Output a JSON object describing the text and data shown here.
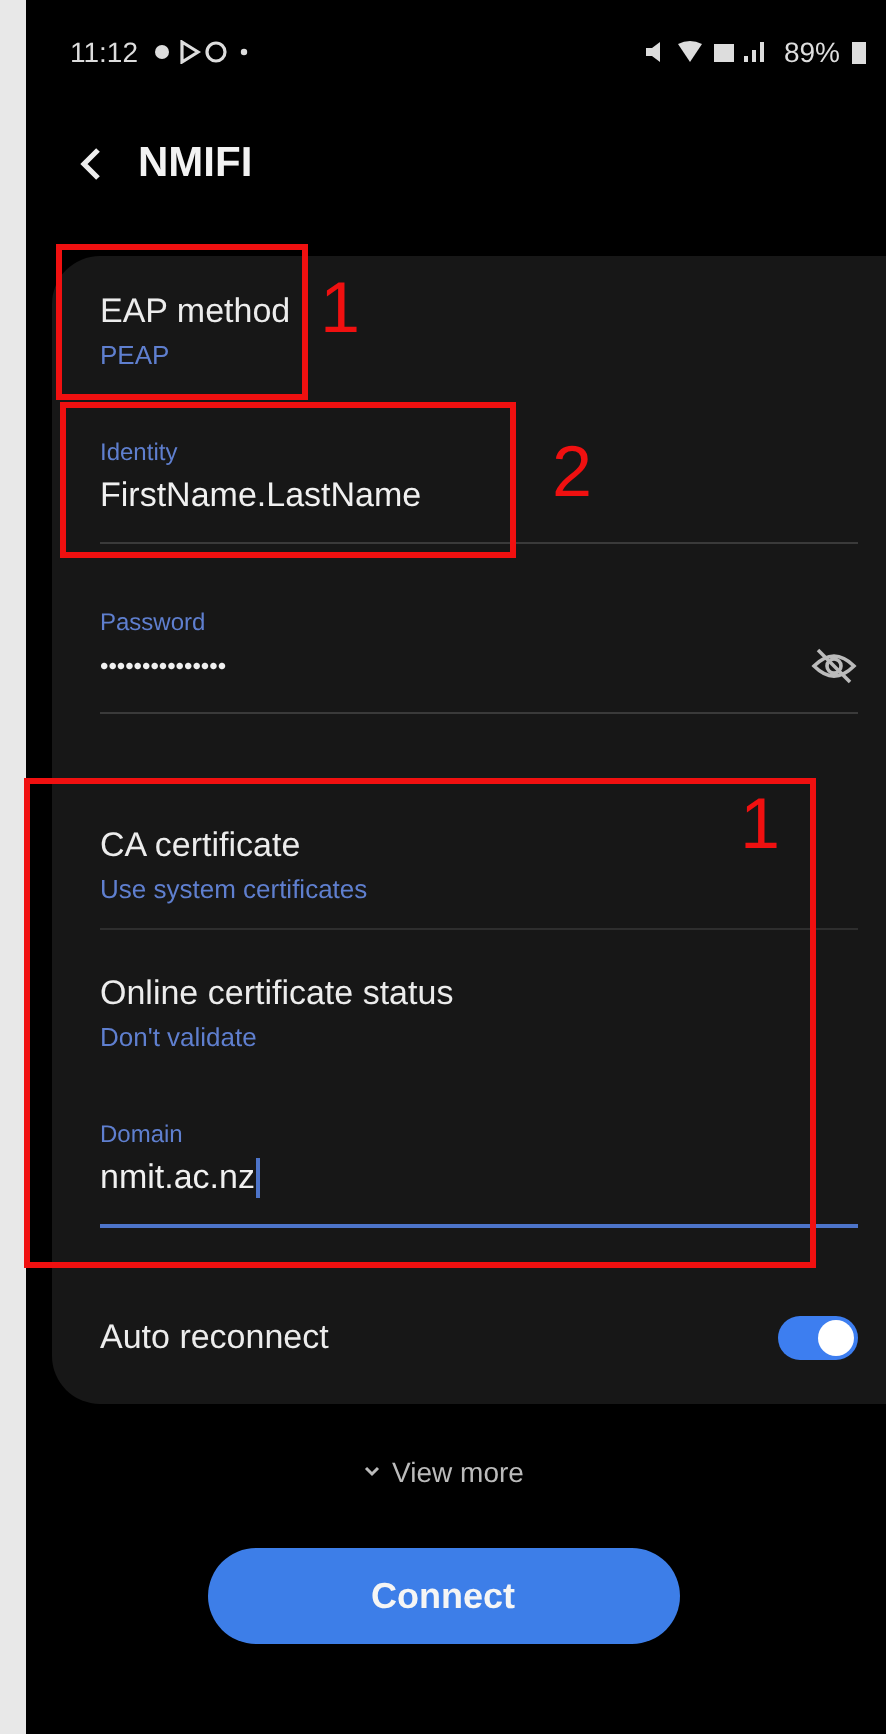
{
  "status_bar": {
    "time": "11:12",
    "battery": "89%"
  },
  "header": {
    "title": "NMIFI"
  },
  "settings": [
    {
      "kind": "setting",
      "title": "EAP method",
      "value": "PEAP"
    },
    {
      "kind": "field",
      "label": "Identity",
      "value": "FirstName.LastName",
      "focused": false,
      "secret": false
    },
    {
      "kind": "field",
      "label": "Password",
      "value": "•••••••••••••••",
      "focused": false,
      "secret": true
    },
    {
      "kind": "setting",
      "title": "CA certificate",
      "value": "Use system certificates"
    },
    {
      "kind": "setting",
      "title": "Online certificate status",
      "value": "Don't validate"
    },
    {
      "kind": "field",
      "label": "Domain",
      "value": "nmit.ac.nz",
      "focused": true,
      "secret": false
    },
    {
      "kind": "toggle",
      "title": "Auto reconnect",
      "on": true
    }
  ],
  "view_more": "View more",
  "connect_button": "Connect",
  "annotations": [
    {
      "number": "1"
    },
    {
      "number": "2"
    },
    {
      "number": "1"
    }
  ]
}
